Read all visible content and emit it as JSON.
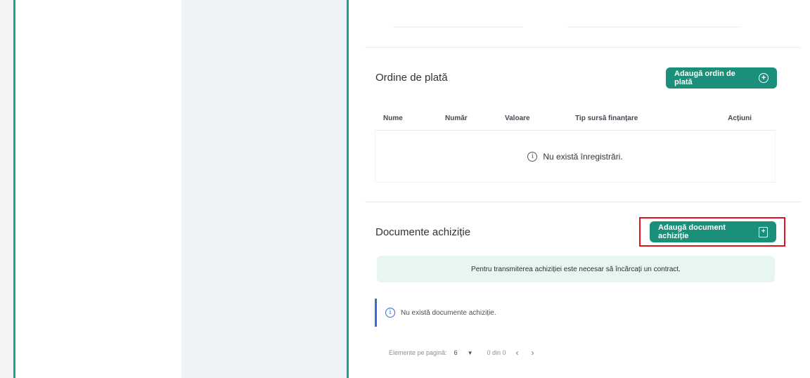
{
  "payment_orders": {
    "title": "Ordine de plată",
    "add_button_label": "Adaugă ordin de plată",
    "columns": [
      "Nume",
      "Număr",
      "Valoare",
      "Tip sursă finanțare",
      "Acțiuni"
    ],
    "empty_message": "Nu există înregistrări."
  },
  "acquisition_documents": {
    "title": "Documente achiziție",
    "add_button_label": "Adaugă document achiziție",
    "notice": "Pentru transmiterea achiziției este necesar să încărcați un contract.",
    "empty_message": "Nu există documente achiziție."
  },
  "pagination": {
    "per_page_label": "Elemente pe pagină:",
    "per_page_value": "6",
    "range_text": "0 din 0",
    "prev_icon": "chevron-left-icon",
    "next_icon": "chevron-right-icon"
  },
  "colors": {
    "accent": "#1a8f79",
    "panel_border": "#1fa38a",
    "highlight": "#e0141c",
    "notice_bg": "#e8f6f2",
    "alert_border": "#2f6fd6"
  }
}
